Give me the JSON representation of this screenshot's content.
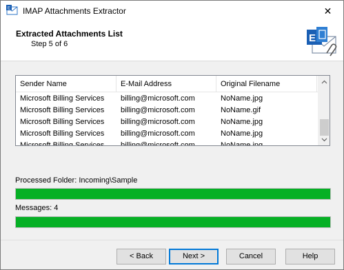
{
  "window": {
    "title": "IMAP Attachments Extractor",
    "close_glyph": "✕"
  },
  "header": {
    "title": "Extracted Attachments List",
    "step": "Step 5 of 6",
    "logo_icon": "exchange-mail-attachment-icon"
  },
  "listview": {
    "columns": [
      "Sender Name",
      "E-Mail Address",
      "Original Filename"
    ],
    "rows": [
      [
        "Microsoft Billing Services",
        "billing@microsoft.com",
        "NoName.jpg"
      ],
      [
        "Microsoft Billing Services",
        "billing@microsoft.com",
        "NoName.gif"
      ],
      [
        "Microsoft Billing Services",
        "billing@microsoft.com",
        "NoName.jpg"
      ],
      [
        "Microsoft Billing Services",
        "billing@microsoft.com",
        "NoName.jpg"
      ],
      [
        "Microsoft Billing Services",
        "billing@microsoft.com",
        "NoName.jpg"
      ]
    ]
  },
  "folder": {
    "label": "Processed Folder: Incoming\\Sample",
    "progress": 1.0
  },
  "messages": {
    "label": "Messages: 4",
    "progress": 1.0
  },
  "buttons": {
    "back": "< Back",
    "next": "Next >",
    "cancel": "Cancel",
    "help": "Help"
  },
  "colors": {
    "progress_green": "#06b025",
    "accent": "#0078d7"
  }
}
